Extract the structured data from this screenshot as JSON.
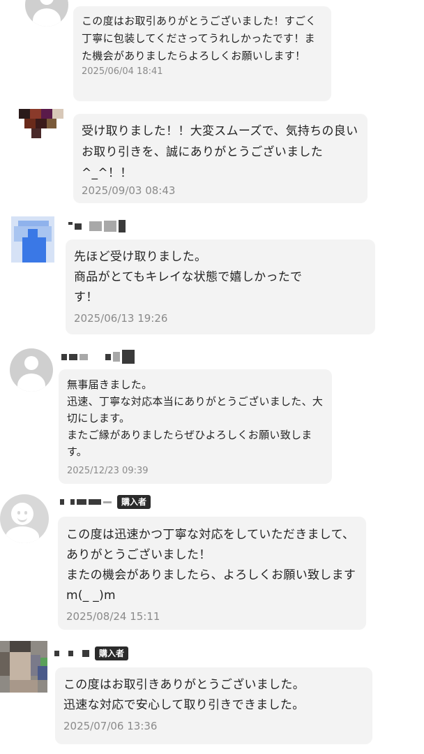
{
  "reviews": [
    {
      "message": "この度はお取引ありがとうございました！すごく丁寧に包装してくださってうれしかったです！また機会がありましたらよろしくお願いします！",
      "timestamp": "2025/06/04 18:41",
      "avatar": "default-user-icon"
    },
    {
      "message": "受け取りました！！大変スムーズで、気持ちの良いお取り引きを、誠にありがとうございました^_^！！",
      "timestamp": "2025/09/03 08:43",
      "avatar": "user-photo"
    },
    {
      "message": "先ほど受け取りました。\n商品がとてもキレイな状態で嬉しかったです！",
      "timestamp": "2025/06/13 19:26",
      "avatar": "user-photo"
    },
    {
      "message": "無事届きました。\n迅速、丁寧な対応本当にありがとうございました、大切にします。\nまたご縁がありましたらぜひよろしくお願い致します。",
      "timestamp": "2025/12/23 09:39",
      "avatar": "default-user-icon"
    },
    {
      "badge": "購入者",
      "message": "この度は迅速かつ丁寧な対応をしていただきまして、ありがとうございました！\nまたの機会がありましたら、よろしくお願い致しますm(_ _)m",
      "timestamp": "2025/08/24 15:11",
      "avatar": "smile-icon"
    },
    {
      "badge": "購入者",
      "message": "この度はお取引きありがとうございました。\n迅速な対応で安心して取り引きできました。",
      "timestamp": "2025/07/06 13:36",
      "avatar": "user-photo"
    }
  ],
  "colors": {
    "bubble": "#f3f3f3",
    "timestamp": "#8a8a8a",
    "badge": "#2b2b2b"
  }
}
